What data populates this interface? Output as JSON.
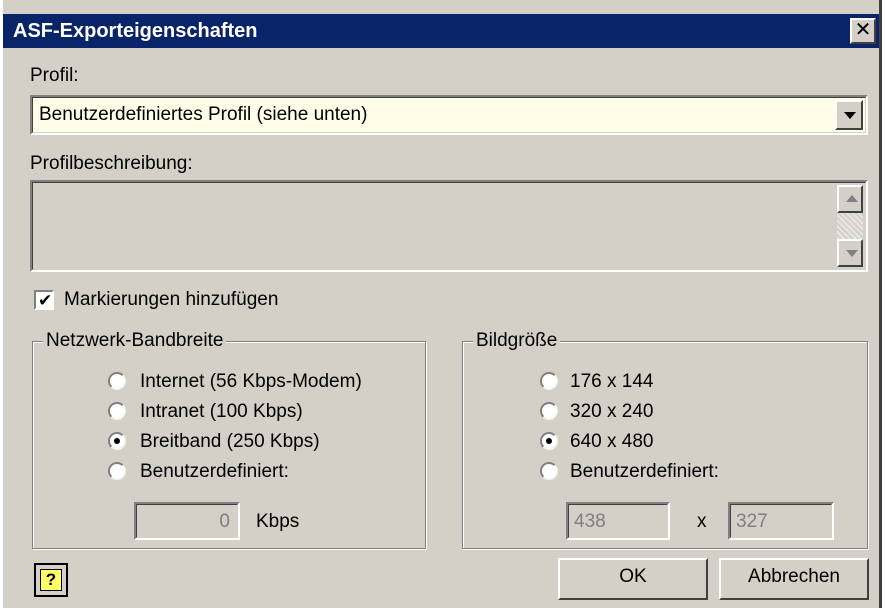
{
  "title_bar": {
    "title": "ASF-Exporteigenschaften",
    "close_glyph": "✕"
  },
  "profile": {
    "label": "Profil:",
    "selected": "Benutzerdefiniertes Profil (siehe unten)"
  },
  "profile_description": {
    "label": "Profilbeschreibung:",
    "value": ""
  },
  "markers": {
    "label": "Markierungen hinzufügen",
    "checked": true
  },
  "bandwidth": {
    "title": "Netzwerk-Bandbreite",
    "options": [
      {
        "label": "Internet (56 Kbps-Modem)",
        "checked": false
      },
      {
        "label": "Intranet (100 Kbps)",
        "checked": false
      },
      {
        "label": "Breitband (250 Kbps)",
        "checked": true
      },
      {
        "label": "Benutzerdefiniert:",
        "checked": false
      }
    ],
    "custom_value": "0",
    "unit": "Kbps"
  },
  "image_size": {
    "title": "Bildgröße",
    "options": [
      {
        "label": "176 x 144",
        "checked": false
      },
      {
        "label": "320 x 240",
        "checked": false
      },
      {
        "label": "640 x 480",
        "checked": true
      },
      {
        "label": "Benutzerdefiniert:",
        "checked": false
      }
    ],
    "width_value": "438",
    "separator": "x",
    "height_value": "327"
  },
  "buttons": {
    "help_glyph": "?",
    "ok": "OK",
    "cancel": "Abbrechen"
  },
  "icons": {
    "help": "help-icon",
    "dropdown": "chevron-down-icon",
    "close": "close-icon"
  },
  "colors": {
    "title_bar": "#0a246a",
    "dialog_face": "#d4d0c8",
    "combo_background": "#fefee8"
  }
}
